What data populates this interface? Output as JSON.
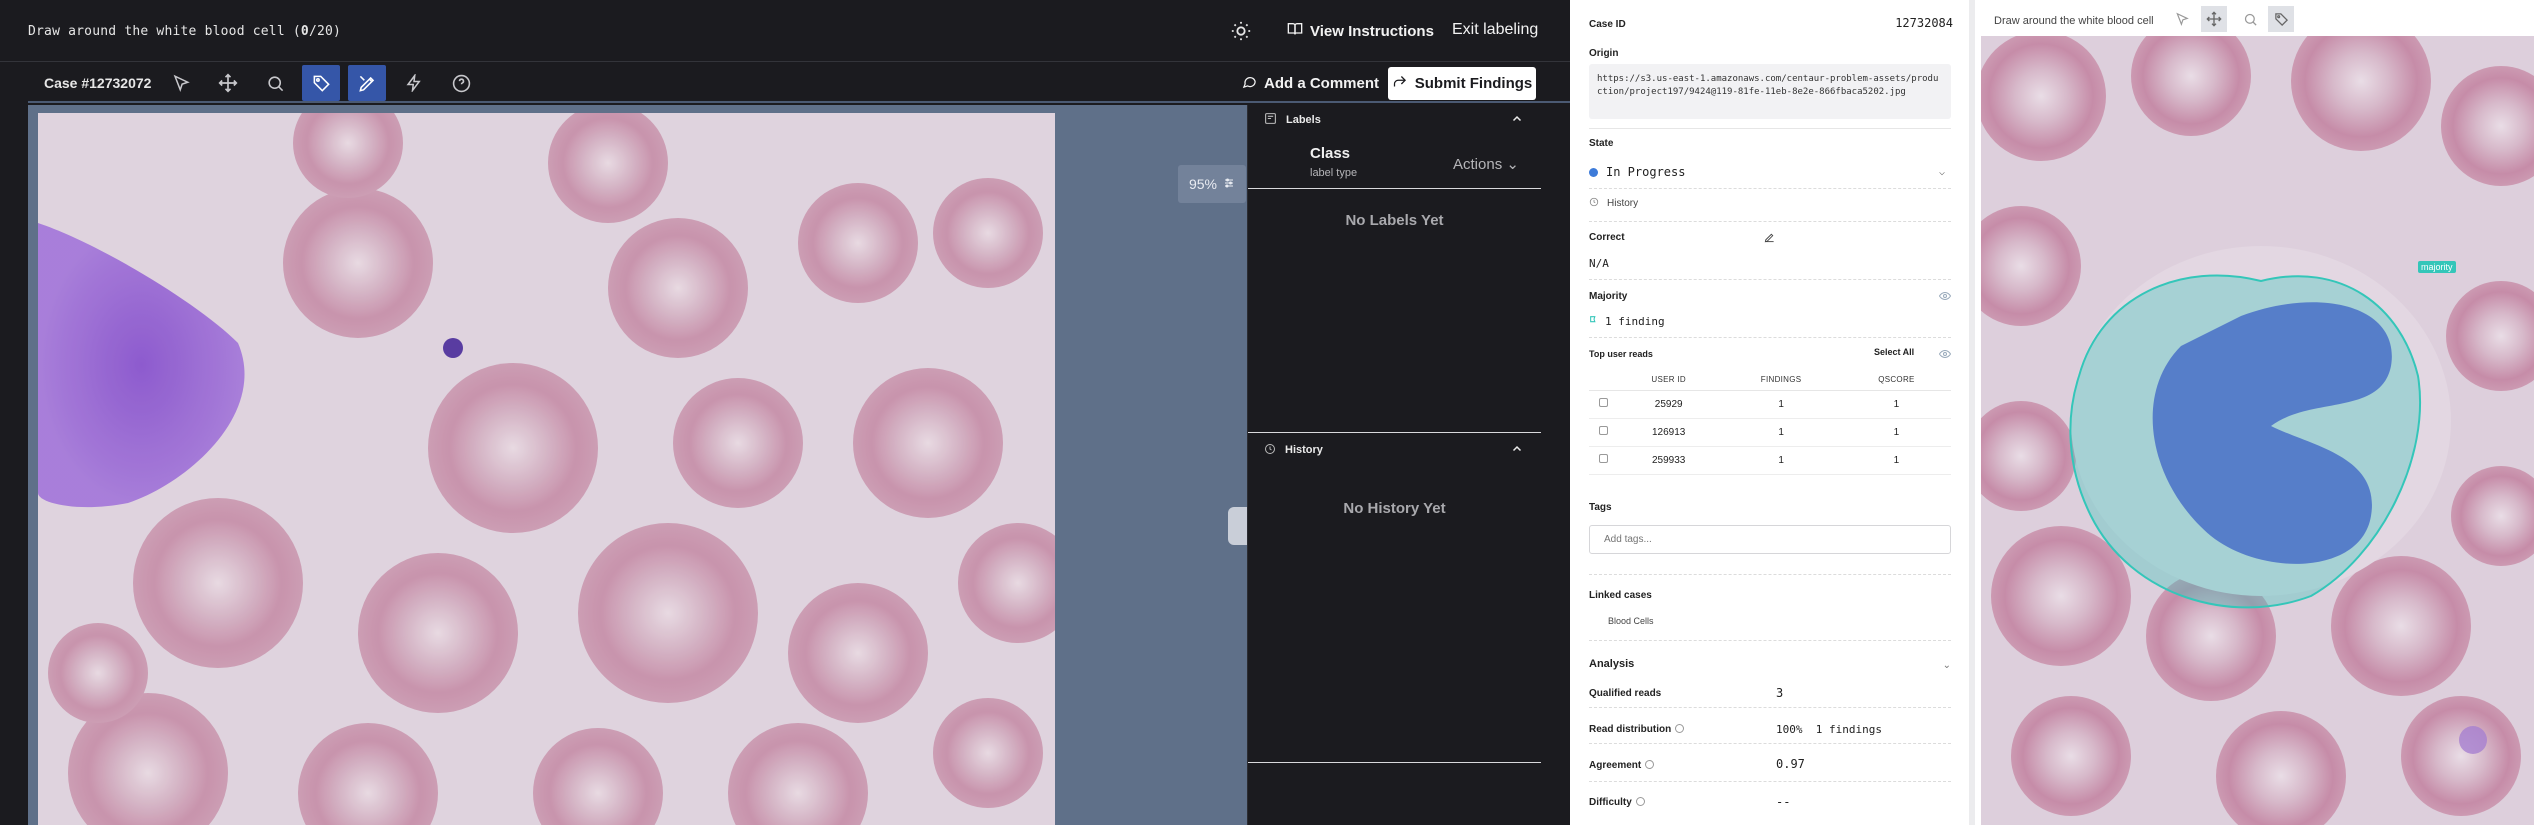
{
  "top_bar": {
    "task_prefix": "Draw around the white blood cell (",
    "task_done": "0",
    "task_suffix": "/20)",
    "view_instructions": "View Instructions",
    "exit_labeling": "Exit labeling"
  },
  "tool_bar": {
    "case_number": "Case #12732072",
    "add_comment": "Add a Comment",
    "submit_findings": "Submit Findings",
    "tools": [
      "cursor-icon",
      "move-icon",
      "zoom-icon",
      "tag-icon",
      "pen-icon",
      "bolt-icon",
      "help-icon"
    ],
    "active_tools": [
      "tag-icon",
      "pen-icon"
    ]
  },
  "canvas": {
    "zoom": "95%"
  },
  "labels_panel": {
    "title": "Labels",
    "class_title": "Class",
    "class_subtitle": "label type",
    "actions": "Actions",
    "empty": "No Labels Yet"
  },
  "history_panel": {
    "title": "History",
    "empty": "No History Yet"
  },
  "detail": {
    "case_id_label": "Case ID",
    "case_id": "12732084",
    "origin_label": "Origin",
    "origin": "https://s3.us-east-1.amazonaws.com/centaur-problem-assets/production/project197/9424@119-81fe-11eb-8e2e-866fbaca5202.jpg",
    "state_label": "State",
    "state": "In Progress",
    "state_color": "#3d7bd9",
    "history_link": "History",
    "correct_label": "Correct",
    "correct": "N/A",
    "majority_label": "Majority",
    "majority": "1 finding",
    "top_reads_label": "Top user reads",
    "select_all": "Select All",
    "reads_columns": [
      "USER ID",
      "FINDINGS",
      "QSCORE"
    ],
    "reads": [
      {
        "user_id": "25929",
        "findings": "1",
        "qscore": "1"
      },
      {
        "user_id": "126913",
        "findings": "1",
        "qscore": "1"
      },
      {
        "user_id": "259933",
        "findings": "1",
        "qscore": "1"
      }
    ],
    "tags_label": "Tags",
    "tags_placeholder": "Add tags...",
    "linked_label": "Linked cases",
    "linked_case": "Blood Cells",
    "analysis_label": "Analysis",
    "qualified_label": "Qualified reads",
    "qualified": "3",
    "distribution_label": "Read distribution",
    "distribution": "100%  1 findings",
    "agreement_label": "Agreement",
    "agreement": "0.97",
    "difficulty_label": "Difficulty",
    "difficulty": "--"
  },
  "reference": {
    "title": "Draw around the white blood cell",
    "majority_tag": "majority"
  }
}
